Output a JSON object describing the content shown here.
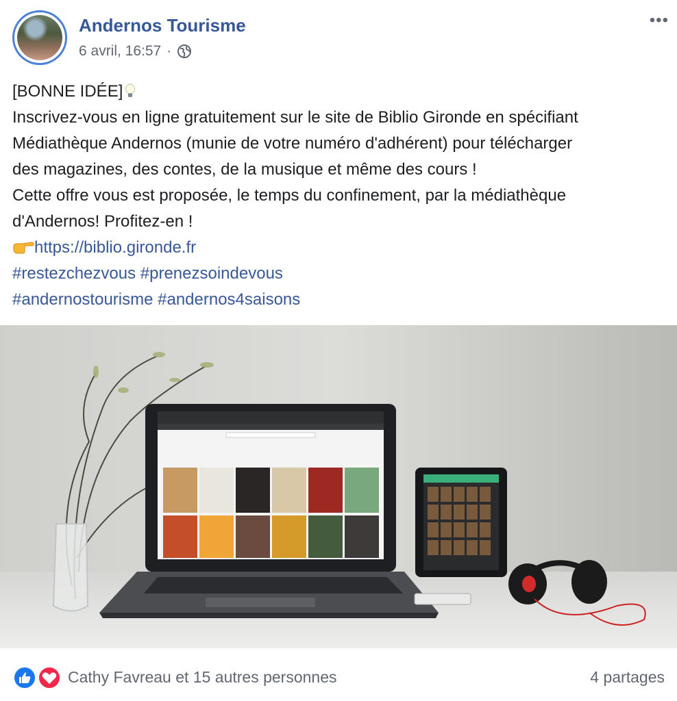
{
  "post": {
    "page_name": "Andernos Tourisme",
    "timestamp": "6 avril, 16:57",
    "separator": "·",
    "visibility_icon": "globe-icon",
    "more_label": "•••",
    "text_lines": [
      "[BONNE IDÉE]",
      "Inscrivez-vous en ligne gratuitement sur le site de Biblio Gironde en spécifiant",
      "Médiathèque Andernos (munie de votre numéro d'adhérent) pour télécharger",
      "des magazines, des contes, de la musique et même des cours !",
      "Cette offre vous est proposée, le temps du confinement, par la médiathèque",
      "d'Andernos! Profitez-en !"
    ],
    "link": "https://biblio.gironde.fr",
    "hashtags": [
      "#restezchezvous",
      "#prenezsoindevous",
      "#andernostourisme",
      "#andernos4saisons"
    ],
    "emoji_icons": [
      "lightbulb-icon",
      "pointing-hand-icon"
    ]
  },
  "footer": {
    "reactions": [
      "like-icon",
      "love-icon"
    ],
    "likers_text": "Cathy Favreau et 15 autres personnes",
    "shares_text": "4 partages"
  },
  "colors": {
    "link": "#385898",
    "page_name": "#365899",
    "meta": "#606770",
    "avatar_ring": "#4a80d6"
  }
}
